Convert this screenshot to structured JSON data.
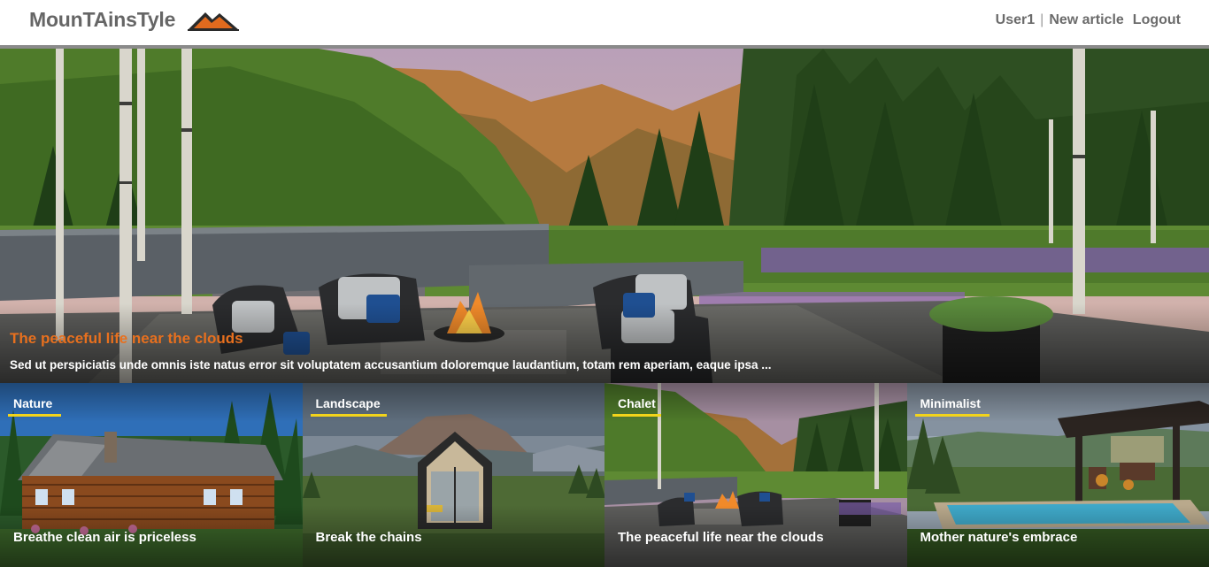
{
  "header": {
    "brand": "MounTAinsTyle",
    "logo_icon": "mountain-logo-icon",
    "nav": {
      "user": "User1",
      "separator": "|",
      "new_article": "New article",
      "logout": "Logout"
    }
  },
  "hero": {
    "title": "The peaceful life near the clouds",
    "excerpt": "Sed ut perspiciatis unde omnis iste natus error sit voluptatem accusantium doloremque laudantium, totam rem aperiam, eaque ipsa ..."
  },
  "cards": [
    {
      "tag": "Nature",
      "title": "Breathe clean air is priceless"
    },
    {
      "tag": "Landscape",
      "title": "Break the chains"
    },
    {
      "tag": "Chalet",
      "title": "The peaceful life near the clouds"
    },
    {
      "tag": "Minimalist",
      "title": "Mother nature's embrace"
    }
  ],
  "colors": {
    "accent_orange": "#e8701e",
    "tag_underline": "#f2d31b",
    "header_bar": "#8a8a8a",
    "brand_text": "#666666"
  }
}
